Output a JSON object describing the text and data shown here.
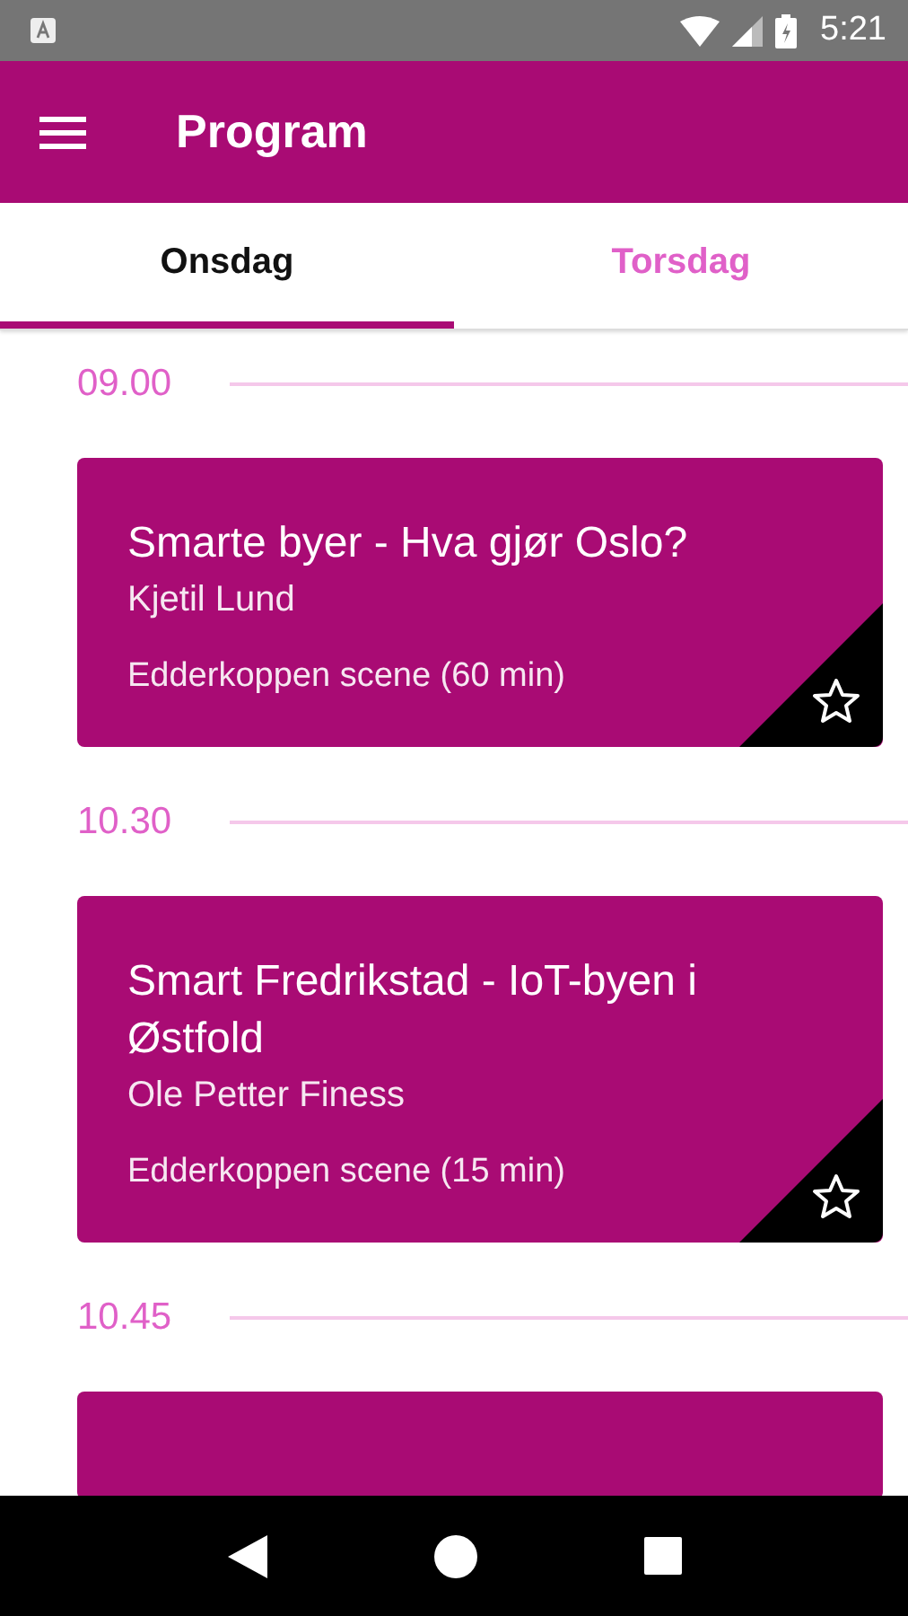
{
  "status_bar": {
    "time": "5:21"
  },
  "app_bar": {
    "title": "Program"
  },
  "tabs": [
    {
      "label": "Onsdag",
      "selected": true
    },
    {
      "label": "Torsdag",
      "selected": false
    }
  ],
  "schedule": [
    {
      "time": "09.00",
      "sessions": [
        {
          "title": "Smarte byer - Hva gjør Oslo?",
          "speaker": "Kjetil Lund",
          "location": "Edderkoppen scene (60 min)",
          "favorite": false
        }
      ]
    },
    {
      "time": "10.30",
      "sessions": [
        {
          "title": "Smart Fredrikstad - IoT-byen i Østfold",
          "speaker": "Ole Petter Finess",
          "location": "Edderkoppen scene (15 min)",
          "favorite": false
        }
      ]
    },
    {
      "time": "10.45",
      "sessions": [
        {
          "kind": "cut"
        }
      ]
    }
  ]
}
